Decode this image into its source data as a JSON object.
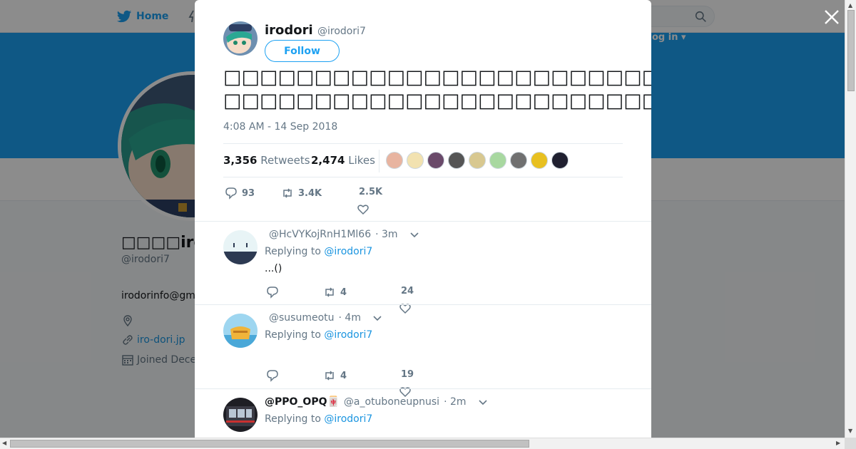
{
  "nav": {
    "home_label": "Home",
    "login_label": "og in ▾"
  },
  "colors": {
    "accent": "#1da1f2",
    "link": "#1b95e0",
    "muted": "#657786",
    "text": "#14171a"
  },
  "profile": {
    "name": "□□□□irodo",
    "handle": "@irodori7",
    "email": "irodorinfo@gm",
    "website": "iro-dori.jp",
    "joined": "Joined Dece"
  },
  "tweet": {
    "author_name": "irodori",
    "author_handle": "@irodori7",
    "follow_label": "Follow",
    "text_line1": "□□□□□□□□□□□□□□□□□□□□□□□□□□□□□□□□□□…□□□…",
    "text_line2": "□□□□□□□□□□□□□□□□□□□□□□□□□□□□□□□□□□□□□□□□□",
    "timestamp": "4:08 AM - 14 Sep 2018",
    "retweets_count": "3,356",
    "retweets_label": "Retweets",
    "likes_count": "2,474",
    "likes_label": "Likes",
    "likers": [
      "#e8b4a0",
      "#f2e2b0",
      "#6a4a6a",
      "#555555",
      "#d8c890",
      "#a8d8a0",
      "#707070",
      "#e8c020",
      "#202030"
    ],
    "actions": {
      "replies": "93",
      "retweets": "3.4K",
      "likes": "2.5K"
    }
  },
  "replies": [
    {
      "name": "",
      "handle": "@HcVYKojRnH1Ml66",
      "time": "· 3m",
      "replying_prefix": "Replying to",
      "replying_to": "@irodori7",
      "text": "...()",
      "retweets": "4",
      "likes": "24"
    },
    {
      "name": "",
      "handle": "@susumeotu",
      "time": "· 4m",
      "replying_prefix": "Replying to",
      "replying_to": "@irodori7",
      "text": "",
      "retweets": "4",
      "likes": "19"
    },
    {
      "name": "@PPO_OPQ🀄",
      "handle": "@a_otuboneupnusi",
      "time": "· 2m",
      "replying_prefix": "Replying to",
      "replying_to": "@irodori7",
      "text": "",
      "retweets": "",
      "likes": ""
    }
  ]
}
